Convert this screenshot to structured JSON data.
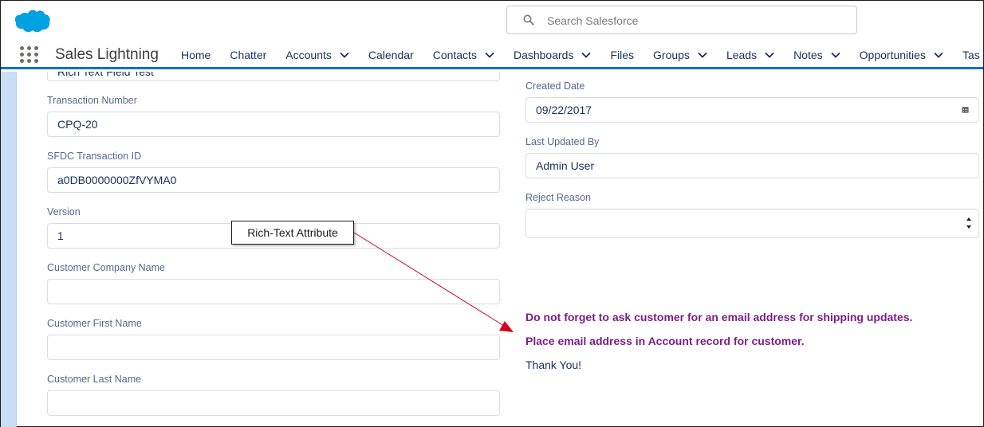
{
  "header": {
    "search_placeholder": "Search Salesforce",
    "app_name": "Sales Lightning",
    "nav": [
      {
        "label": "Home",
        "dropdown": false
      },
      {
        "label": "Chatter",
        "dropdown": false
      },
      {
        "label": "Accounts",
        "dropdown": true
      },
      {
        "label": "Calendar",
        "dropdown": false
      },
      {
        "label": "Contacts",
        "dropdown": true
      },
      {
        "label": "Dashboards",
        "dropdown": true
      },
      {
        "label": "Files",
        "dropdown": false
      },
      {
        "label": "Groups",
        "dropdown": true
      },
      {
        "label": "Leads",
        "dropdown": true
      },
      {
        "label": "Notes",
        "dropdown": true
      },
      {
        "label": "Opportunities",
        "dropdown": true
      },
      {
        "label": "Tas",
        "dropdown": false
      }
    ]
  },
  "form_left": {
    "top_field_value": "Rich Text Field Test",
    "transaction_number": {
      "label": "Transaction Number",
      "value": "CPQ-20"
    },
    "sfdc_transaction_id": {
      "label": "SFDC Transaction ID",
      "value": "a0DB0000000ZfVYMA0"
    },
    "version": {
      "label": "Version",
      "value": "1"
    },
    "customer_company_name": {
      "label": "Customer Company Name",
      "value": ""
    },
    "customer_first_name": {
      "label": "Customer First Name",
      "value": ""
    },
    "customer_last_name": {
      "label": "Customer Last Name",
      "value": ""
    }
  },
  "form_right": {
    "created_date": {
      "label": "Created Date",
      "value": "09/22/2017"
    },
    "last_updated_by": {
      "label": "Last Updated By",
      "value": "Admin User"
    },
    "reject_reason": {
      "label": "Reject Reason",
      "value": ""
    }
  },
  "rich_text": {
    "line1": "Do not forget to ask customer for an email address for shipping updates.",
    "line2": "Place email address in Account record for customer.",
    "line3": "Thank You!"
  },
  "callout": {
    "label": "Rich-Text Attribute"
  },
  "colors": {
    "brand": "#0070d2",
    "rich_text": "#7c1e87",
    "arrow": "#d0021b"
  },
  "icons": {
    "logo": "salesforce-cloud-logo",
    "search": "search-icon",
    "apps": "app-launcher-icon",
    "calendar": "calendar-icon",
    "spinner": "spinner-icon"
  }
}
